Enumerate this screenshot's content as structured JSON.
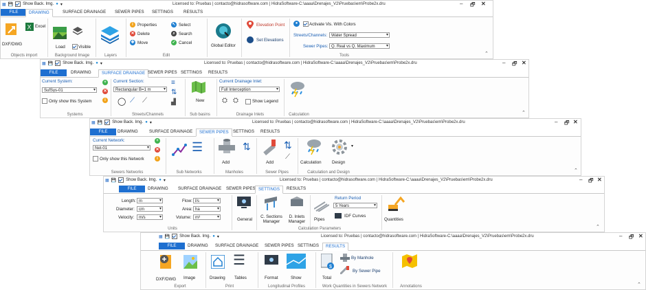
{
  "common": {
    "show_back_img": "Show Back. Img.",
    "license_text": "Licensed to: Pruebas | contacto@hidrasoftware.com | HidraSoftware-C:\\aaaa\\Drenajes_V2\\Pruebas\\em\\Probe2x.dru",
    "tabs": [
      "FILE",
      "DRAWING",
      "SURFACE DRAINAGE",
      "SEWER PIPES",
      "SETTINGS",
      "RESULTS"
    ],
    "window_controls": [
      "–",
      "🗗",
      "✕"
    ]
  },
  "w1": {
    "active_tab": "DRAWING",
    "tabs_display": [
      "FILE",
      "DRAWING",
      "SURFACE DRAINAGE",
      "SEWER PIPES",
      "SETTINGS",
      "RESULTS"
    ],
    "dxf_dwg": "DXF/DWG",
    "excel": "Excel",
    "objects_import": "Objects import",
    "load": "Load",
    "visible": "Visible",
    "background_image": "Background Image",
    "layers": "Layers",
    "properties": "Properties",
    "delete": "Delete",
    "move": "Move",
    "select": "Select",
    "search": "Search",
    "cancel": "Cancel",
    "edit": "Edit",
    "global_editor": "Global Editor",
    "elevation_point": "Elevation Point",
    "set_elevations": "Set Elevations",
    "activate_vis": "Activate Vis. With Colors",
    "streets_channels_label": "Streets/Channels:",
    "streets_channels_value": "Water Spread",
    "sewer_pipes_label": "Sewer Pipes:",
    "sewer_pipes_value": "Q. Real vs Q. Maximum",
    "tools": "Tools"
  },
  "w2": {
    "active_tab": "SURFACE DRAINAGE",
    "tabs_display": [
      "FILE",
      "DRAWING",
      "SURFACE DRAINAGE",
      "SEWER PIPES",
      "SETTINGS",
      "RESULTS"
    ],
    "current_system": "Current System:",
    "system_value": "SufSys-01",
    "only_show_system": "Only show this System",
    "systems": "Systems",
    "current_section": "Current Section:",
    "section_value": "Rectangular B=1 m",
    "streets_channels": "Streets/Channels",
    "new": "New",
    "sub_basins": "Sub basins",
    "current_inlet": "Current Drainage Inlet:",
    "inlet_value": "Full Interception",
    "show_legend": "Show Legend",
    "drainage_inlets": "Drainage Inlets",
    "calculation": "Calculation"
  },
  "w3": {
    "active_tab": "SEWER PIPES",
    "current_network": "Current Network:",
    "network_value": "Net-01",
    "only_show_network": "Only show this Network",
    "sewers_networks": "Sewers Networks",
    "sub_networks": "Sub Networks",
    "add": "Add",
    "manholes": "Manholes",
    "sewer_pipes": "Sewer Pipes",
    "calculation": "Calculation",
    "design": "Design",
    "calc_and_design": "Calculation and Design"
  },
  "w4": {
    "active_tab": "SETTINGS",
    "length_label": "Length:",
    "length_value": "m",
    "diameter_label": "Diameter:",
    "diameter_value": "cm",
    "velocity_label": "Velocity:",
    "velocity_value": "m/s",
    "flow_label": "Flow:",
    "flow_value": "l/s",
    "area_label": "Area:",
    "area_value": "ha",
    "volume_label": "Volume:",
    "volume_value": "m³",
    "units": "Units",
    "general": "General",
    "c_sections_manager": "C. Sections Manager",
    "d_inlets_manager": "D. Inlets Manager",
    "pipes": "Pipes",
    "return_period": "Return Period",
    "return_period_value": "5 Years",
    "idf_curves": "IDF Curves",
    "quantities": "Quantities",
    "calculation_parameters": "Calculation Parameters"
  },
  "w5": {
    "active_tab": "RESULTS",
    "dxf_dwg": "DXF/DWG",
    "image": "Image",
    "export": "Export",
    "drawing": "Drawing",
    "tables": "Tables",
    "print": "Print",
    "format": "Format",
    "show": "Show",
    "longitudinal_profiles": "Longitudinal Profiles",
    "total": "Total",
    "by_manhole": "By Manhole",
    "by_sewer_pipe": "By Sewer Pipe",
    "work_quantities": "Work Quantities in Sewers Network",
    "annotations": "Annotations"
  }
}
